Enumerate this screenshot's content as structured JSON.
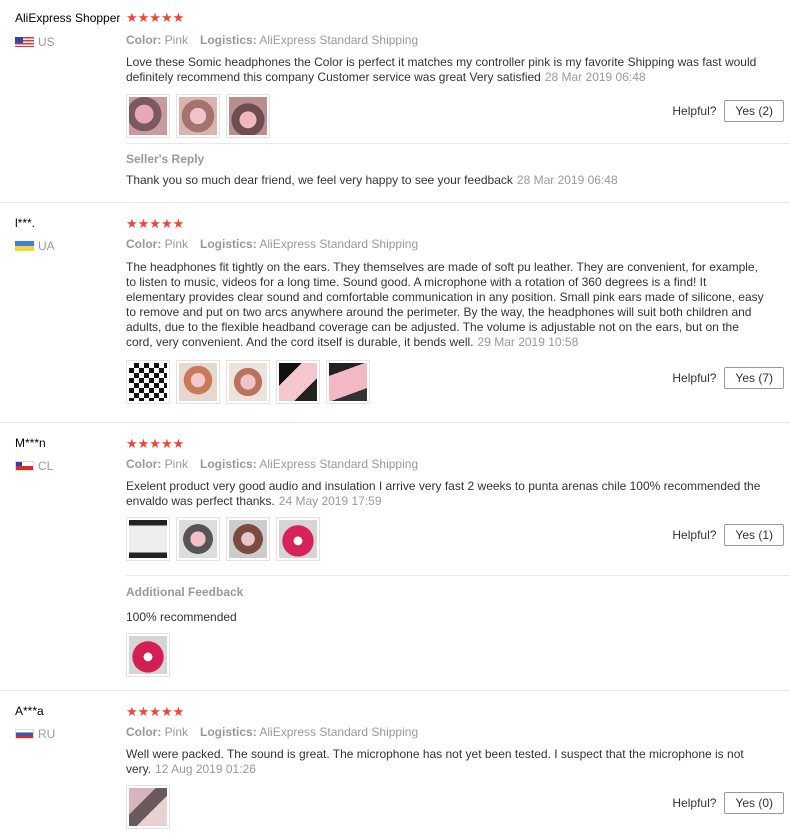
{
  "helpful_label": "Helpful?",
  "color_label": "Color:",
  "logistics_label": "Logistics:",
  "star_color": "#f44336",
  "reviews": [
    {
      "user": "AliExpress Shopper",
      "country": "US",
      "stars": "★★★★★",
      "rating": 5,
      "color": "Pink",
      "logistics": "AliExpress Standard Shipping",
      "text": "Love these Somic headphones the Color is perfect it matches my controller pink is my favorite Shipping was fast would definitely recommend this company Customer service was great Very satisfied",
      "date": "28 Mar 2019 06:48",
      "helpful": "Yes (2)",
      "reply_title": "Seller's Reply",
      "reply_text": "Thank you so much dear friend, we feel very happy to see your feedback",
      "reply_date": "28 Mar 2019 06:48"
    },
    {
      "user": "l***.",
      "country": "UA",
      "stars": "★★★★★",
      "rating": 5,
      "color": "Pink",
      "logistics": "AliExpress Standard Shipping",
      "text": "The headphones fit tightly on the ears. They themselves are made of soft pu leather. They are convenient, for example, to listen to music, videos for a long time. Sound good. A microphone with a rotation of 360 degrees is a find! It elementary provides clear sound and comfortable communication in any position. Small pink ears made of silicone, easy to remove and put on two arcs anywhere around the perimeter. By the way, the headphones will suit both children and adults, due to the flexible headband coverage can be adjusted. The volume is adjustable not on the ears, but on the cord, very convenient. And the cord itself is durable, it bends well.",
      "date": "29 Mar 2019 10:58",
      "helpful": "Yes (7)"
    },
    {
      "user": "M***n",
      "country": "CL",
      "stars": "★★★★★",
      "rating": 5,
      "color": "Pink",
      "logistics": "AliExpress Standard Shipping",
      "text": "Exelent product very good audio and insulation I arrive very fast 2 weeks to punta arenas chile 100% recommended the envaldo was perfect thanks.",
      "date": "24 May 2019 17:59",
      "helpful": "Yes (1)",
      "additional_title": "Additional Feedback",
      "additional_text": "100% recommended"
    },
    {
      "user": "A***a",
      "country": "RU",
      "stars": "★★★★★",
      "rating": 5,
      "color": "Pink",
      "logistics": "AliExpress Standard Shipping",
      "text": "Well were packed. The sound is great. The microphone has not yet been tested. I suspect that the microphone is not very.",
      "date": "12 Aug 2019 01:26",
      "helpful": "Yes (0)"
    }
  ]
}
